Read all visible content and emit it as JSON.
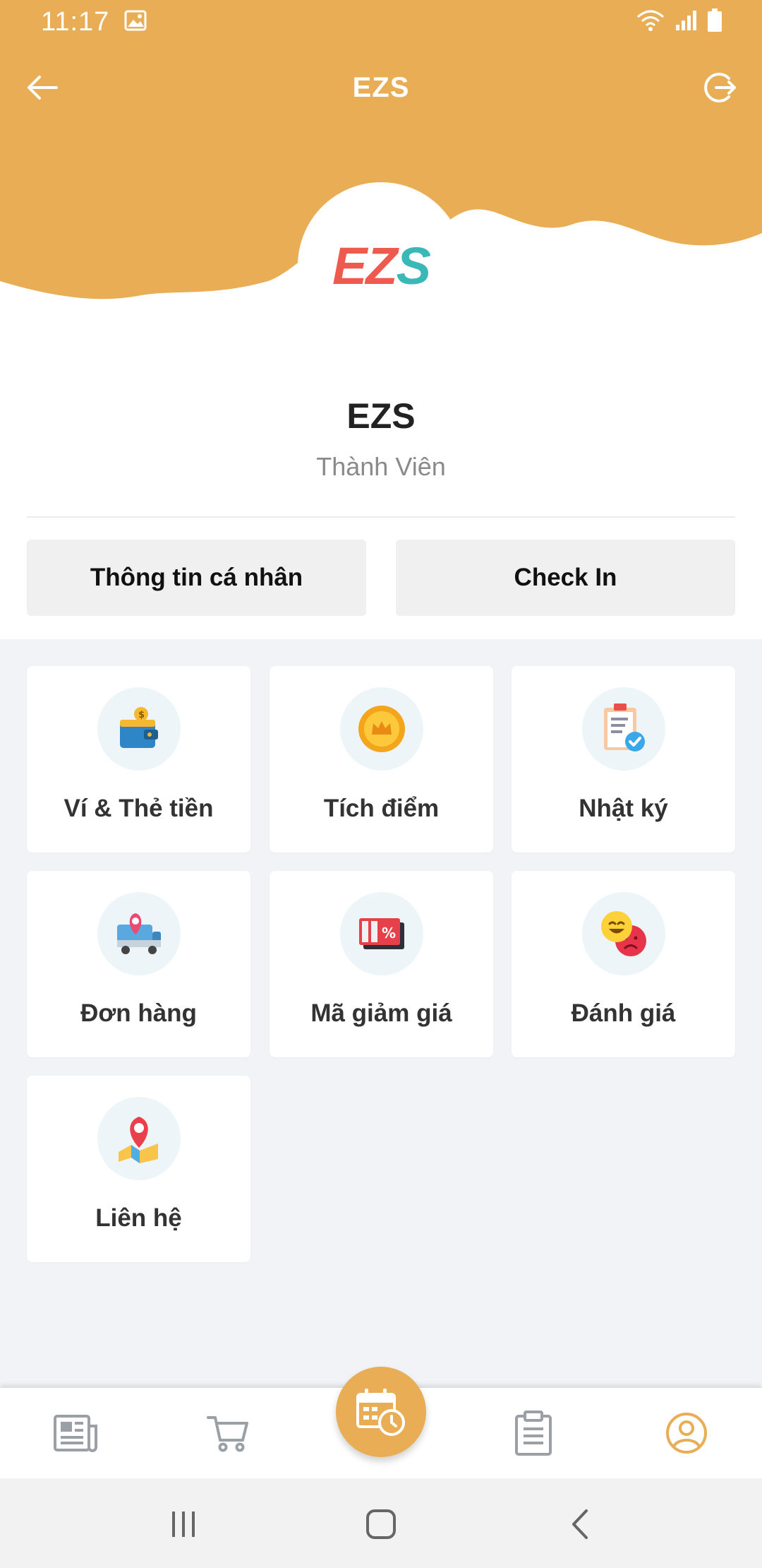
{
  "status_bar": {
    "time": "11:17",
    "icons": [
      "image-icon",
      "wifi-icon",
      "signal-icon",
      "battery-icon"
    ]
  },
  "app_bar": {
    "title": "EZS",
    "back_icon": "arrow-left-icon",
    "logout_icon": "logout-icon"
  },
  "logo": {
    "part1": "EZ",
    "part2": "S",
    "colors": {
      "part1": "#ef5a4f",
      "part2": "#3ab8b8"
    }
  },
  "profile": {
    "name": "EZS",
    "role": "Thành Viên"
  },
  "actions": {
    "profile_info": "Thông tin cá nhân",
    "check_in": "Check In"
  },
  "menu": [
    {
      "label": "Ví & Thẻ tiền",
      "icon": "wallet-icon"
    },
    {
      "label": "Tích điểm",
      "icon": "crown-coin-icon"
    },
    {
      "label": "Nhật ký",
      "icon": "clipboard-check-icon"
    },
    {
      "label": "Đơn hàng",
      "icon": "delivery-truck-icon"
    },
    {
      "label": "Mã giảm giá",
      "icon": "coupon-icon"
    },
    {
      "label": "Đánh giá",
      "icon": "emoji-faces-icon"
    },
    {
      "label": "Liên hệ",
      "icon": "map-pin-icon"
    }
  ],
  "bottom_nav": {
    "items": [
      "news-icon",
      "cart-icon",
      "calendar-clock-icon",
      "clipboard-list-icon",
      "user-circle-icon"
    ],
    "active": "user-circle-icon"
  },
  "colors": {
    "brand": "#e9ad55",
    "active_nav": "#e9ad55",
    "inactive_nav": "#9aa0a6"
  }
}
